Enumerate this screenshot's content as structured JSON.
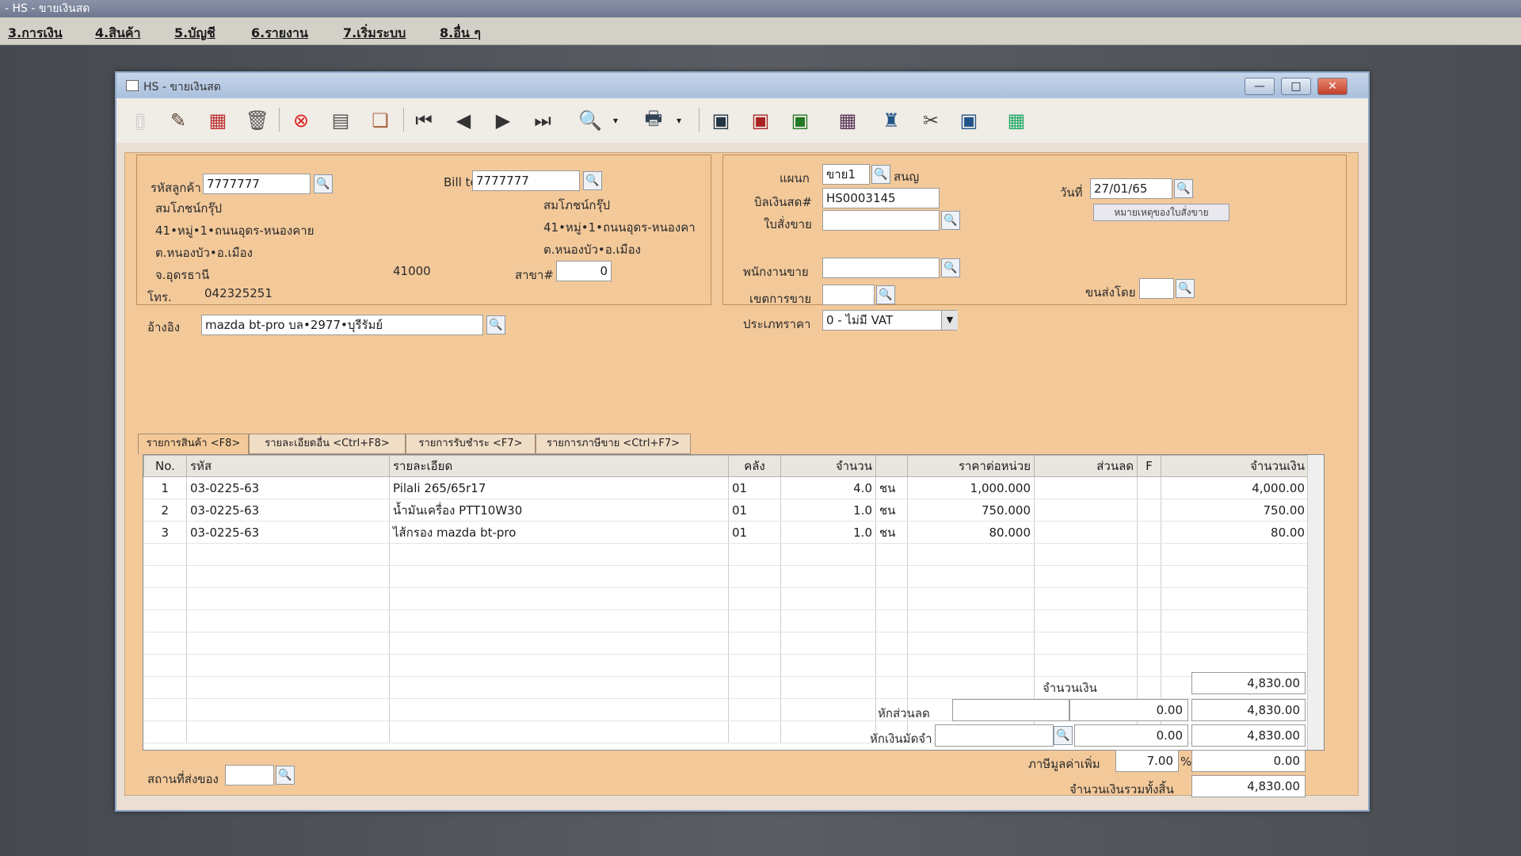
{
  "app_title": "- HS - ขายเงินสด",
  "menu": [
    "3.การเงิน",
    "4.สินค้า",
    "5.บัญชี",
    "6.รายงาน",
    "7.เริ่มระบบ",
    "8.อื่น ๆ"
  ],
  "window": {
    "title": "HS - ขายเงินสด",
    "minimize": "—",
    "maximize": "□",
    "close": "✕"
  },
  "customer": {
    "code_label": "รหัสลูกค้า",
    "code": "7777777",
    "name": "สมโภชน์กรุ๊ป",
    "addr1": "41•หมู่•1•ถนนอุดร-หนองคาย",
    "addr2": "ต.หนองบัว•อ.เมือง",
    "addr3": "จ.อุดรธานี",
    "zip": "41000",
    "phone_label": "โทร.",
    "phone": "042325251",
    "ref_label": "อ้างอิง",
    "ref": "mazda bt-pro บล•2977•บุรีรัมย์"
  },
  "billto": {
    "label": "Bill to",
    "code": "7777777",
    "name": "สมโภชน์กรุ๊ป",
    "addr1": "41•หมู่•1•ถนนอุดร-หนองคา",
    "addr2": "ต.หนองบัว•อ.เมือง",
    "branch_label": "สาขา#",
    "branch": "0"
  },
  "doc": {
    "dept_label": "แผนก",
    "dept": "ขาย1",
    "dept_name": "สนญ",
    "bill_label": "บิลเงินสด#",
    "bill": "HS0003145",
    "order_label": "ใบสั่งขาย",
    "order": "",
    "sales_label": "พนักงานขาย",
    "sales": "",
    "area_label": "เขตการขาย",
    "area": "",
    "price_label": "ประเภทราคา",
    "price": "0 - ไม่มี VAT",
    "date_label": "วันที่",
    "date": "27/01/65",
    "note_button": "หมายเหตุของใบสั่งขาย",
    "ship_label": "ขนส่งโดย",
    "ship": ""
  },
  "tabs": [
    "รายการสินค้า <F8>",
    "รายละเอียดอื่น <Ctrl+F8>",
    "รายการรับชำระ <F7>",
    "รายการภาษีขาย <Ctrl+F7>"
  ],
  "grid": {
    "headers": [
      "No.",
      "รหัส",
      "รายละเอียด",
      "คลัง",
      "จำนวน",
      "",
      "ราคาต่อหน่วย",
      "ส่วนลด",
      "F",
      "จำนวนเงิน"
    ],
    "rows": [
      {
        "no": "1",
        "code": "03-0225-63",
        "desc": "Pilali 265/65r17",
        "wh": "01",
        "qty": "4.0",
        "unit": "ชน",
        "price": "1,000.000",
        "disc": "",
        "f": "",
        "amount": "4,000.00"
      },
      {
        "no": "2",
        "code": "03-0225-63",
        "desc": "น้ำมันเครื่อง PTT10W30",
        "wh": "01",
        "qty": "1.0",
        "unit": "ชน",
        "price": "750.000",
        "disc": "",
        "f": "",
        "amount": "750.00"
      },
      {
        "no": "3",
        "code": "03-0225-63",
        "desc": "ไส้กรอง mazda bt-pro",
        "wh": "01",
        "qty": "1.0",
        "unit": "ชน",
        "price": "80.000",
        "disc": "",
        "f": "",
        "amount": "80.00"
      }
    ]
  },
  "footer": {
    "delivery_label": "สถานที่ส่งของ",
    "delivery": "",
    "amount_label": "จำนวนเงิน",
    "amount": "4,830.00",
    "discount_label": "หักส่วนลด",
    "discount_input": "",
    "discount": "0.00",
    "after_discount": "4,830.00",
    "deposit_label": "หักเงินมัดจำ",
    "deposit_input": "",
    "deposit": "0.00",
    "after_deposit": "4,830.00",
    "vat_label": "ภาษีมูลค่าเพิ่ม",
    "vat_rate": "7.00",
    "vat_pct": "%",
    "vat": "0.00",
    "total_label": "จำนวนเงินรวมทั้งสิ้น",
    "total": "4,830.00"
  }
}
